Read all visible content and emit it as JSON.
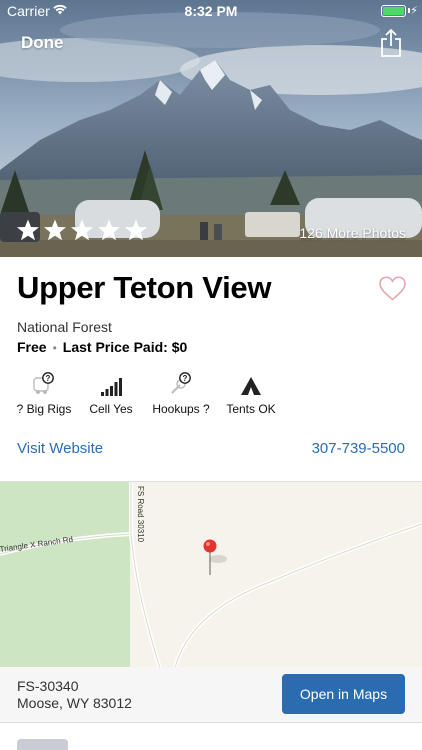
{
  "status_bar": {
    "carrier": "Carrier",
    "time": "8:32 PM"
  },
  "header": {
    "done_label": "Done"
  },
  "hero": {
    "rating": 5,
    "more_photos": "126 More Photos"
  },
  "listing": {
    "title": "Upper Teton View",
    "category": "National Forest",
    "price": "Free",
    "last_price": "Last Price Paid: $0"
  },
  "amenities": [
    {
      "label": "? Big Rigs",
      "icon": "big-rig-unknown-icon"
    },
    {
      "label": "Cell Yes",
      "icon": "cell-signal-icon"
    },
    {
      "label": "Hookups ?",
      "icon": "hookups-unknown-icon"
    },
    {
      "label": "Tents OK",
      "icon": "tent-icon"
    }
  ],
  "links": {
    "website": "Visit Website",
    "phone": "307-739-5500"
  },
  "map": {
    "road_label": "FS Road 30310",
    "road_label_2": "Triangle X Ranch Rd"
  },
  "address": {
    "line1": "FS-30340",
    "line2": "Moose, WY 83012",
    "open_maps": "Open in Maps"
  },
  "colors": {
    "accent": "#2a6db5",
    "button": "#2b6cb0",
    "heart": "#e7a1ac"
  }
}
